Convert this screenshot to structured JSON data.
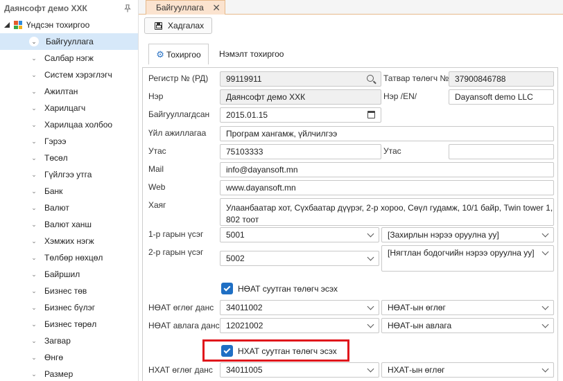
{
  "sidebar": {
    "title": "Даянсофт демо ХХК",
    "root_label": "Үндсэн тохиргоо",
    "items": [
      {
        "label": "Байгууллага",
        "selected": true
      },
      {
        "label": "Салбар нэгж"
      },
      {
        "label": "Систем хэрэглэгч"
      },
      {
        "label": "Ажилтан"
      },
      {
        "label": "Харилцагч"
      },
      {
        "label": "Харилцаа холбоо"
      },
      {
        "label": "Гэрээ"
      },
      {
        "label": "Төсөл"
      },
      {
        "label": "Гүйлгээ утга"
      },
      {
        "label": "Банк"
      },
      {
        "label": "Валют"
      },
      {
        "label": "Валют ханш"
      },
      {
        "label": "Хэмжих нэгж"
      },
      {
        "label": "Төлбөр нөхцөл"
      },
      {
        "label": "Байршил"
      },
      {
        "label": "Бизнес төв"
      },
      {
        "label": "Бизнес бүлэг"
      },
      {
        "label": "Бизнес төрөл"
      },
      {
        "label": "Загвар"
      },
      {
        "label": "Өнгө"
      },
      {
        "label": "Размер"
      }
    ]
  },
  "doc_tab": {
    "label": "Байгууллага",
    "close": "✕"
  },
  "toolbar": {
    "save_label": "Хадгалах"
  },
  "tabs": {
    "settings": "Тохиргоо",
    "extra": "Нэмэлт тохиргоо"
  },
  "form": {
    "reg_label": "Регистр № (РД)",
    "reg_value": "99119911",
    "taxpayer_label": "Татвар төлөгч №",
    "taxpayer_value": "37900846788",
    "name_label": "Нэр",
    "name_value": "Даянсофт демо ХХК",
    "name_en_label": "Нэр /EN/",
    "name_en_value": "Dayansoft demo LLC",
    "founded_label": "Байгууллагдсан",
    "founded_value": "2015.01.15",
    "activity_label": "Үйл ажиллагаа",
    "activity_value": "Програм хангамж, үйлчилгээ",
    "phone_label": "Утас",
    "phone_value": "75103333",
    "phone2_label": "Утас",
    "phone2_value": "",
    "mail_label": "Mail",
    "mail_value": "info@dayansoft.mn",
    "web_label": "Web",
    "web_value": "www.dayansoft.mn",
    "address_label": "Хаяг",
    "address_value": "Улаанбаатар хот, Сүхбаатар дүүрэг, 2-р хороо, Сөүл гудамж, 10/1 байр, Twin tower 1, 802 тоот",
    "sig1_label": "1-р гарын үсэг",
    "sig1_code": "5001",
    "sig1_name": "[Захирлын нэрээ оруулна уу]",
    "sig2_label": "2-р гарын үсэг",
    "sig2_code": "5002",
    "sig2_name": "[Нягтлан бодогчийн нэрээ оруулна уу]",
    "vat_checkbox": "НӨАТ суутган төлөгч эсэх",
    "vat_payable_label": "НӨАТ өглөг данс",
    "vat_payable_code": "34011002",
    "vat_payable_name": "НӨАТ-ын өглөг",
    "vat_recv_label": "НӨАТ авлага данс",
    "vat_recv_code": "12021002",
    "vat_recv_name": "НӨАТ-ын авлага",
    "cit_checkbox": "НХАТ суутган төлөгч эсэх",
    "cit_payable_label": "НХАТ өглөг данс",
    "cit_payable_code": "34011005",
    "cit_payable_name": "НХАТ-ын өглөг"
  },
  "colors": {
    "accent": "#1f6fc4",
    "selected_bg": "#d6e8f9",
    "highlight": "#e0141b",
    "doc_tab_bg": "#fbe3cf"
  }
}
